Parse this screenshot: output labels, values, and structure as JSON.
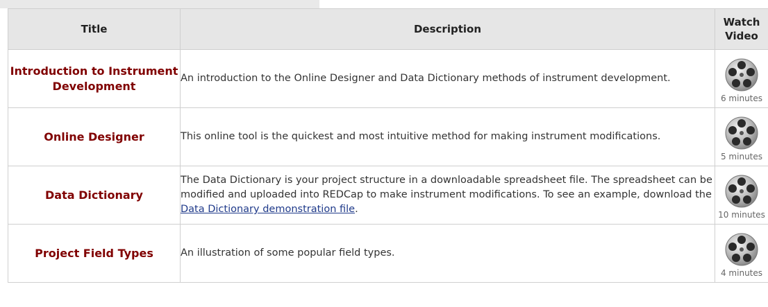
{
  "table": {
    "headers": {
      "title": "Title",
      "description": "Description",
      "watch_video": "Watch Video"
    },
    "rows": [
      {
        "title": "Introduction to Instrument Development",
        "description": "An introduction to the Online Designer and Data Dictionary methods of instrument development.",
        "duration": "6 minutes",
        "icon": "film-reel-icon"
      },
      {
        "title": "Online Designer",
        "description": "This online tool is the quickest and most intuitive method for making instrument modifications.",
        "duration": "5 minutes",
        "icon": "film-reel-icon"
      },
      {
        "title": "Data Dictionary",
        "description_prefix": "The Data Dictionary is your project structure in a downloadable spreadsheet file. The spreadsheet can be modified and uploaded into REDCap to make instrument modifications. To see an example, download the ",
        "description_link": "Data Dictionary demonstration file",
        "description_suffix": ".",
        "duration": "10 minutes",
        "icon": "film-reel-icon"
      },
      {
        "title": "Project Field Types",
        "description": "An illustration of some popular field types.",
        "duration": "4 minutes",
        "icon": "film-reel-icon"
      }
    ]
  },
  "colors": {
    "title_text": "#800000",
    "header_bg": "#e6e6e6",
    "link": "#1f3a8a"
  }
}
